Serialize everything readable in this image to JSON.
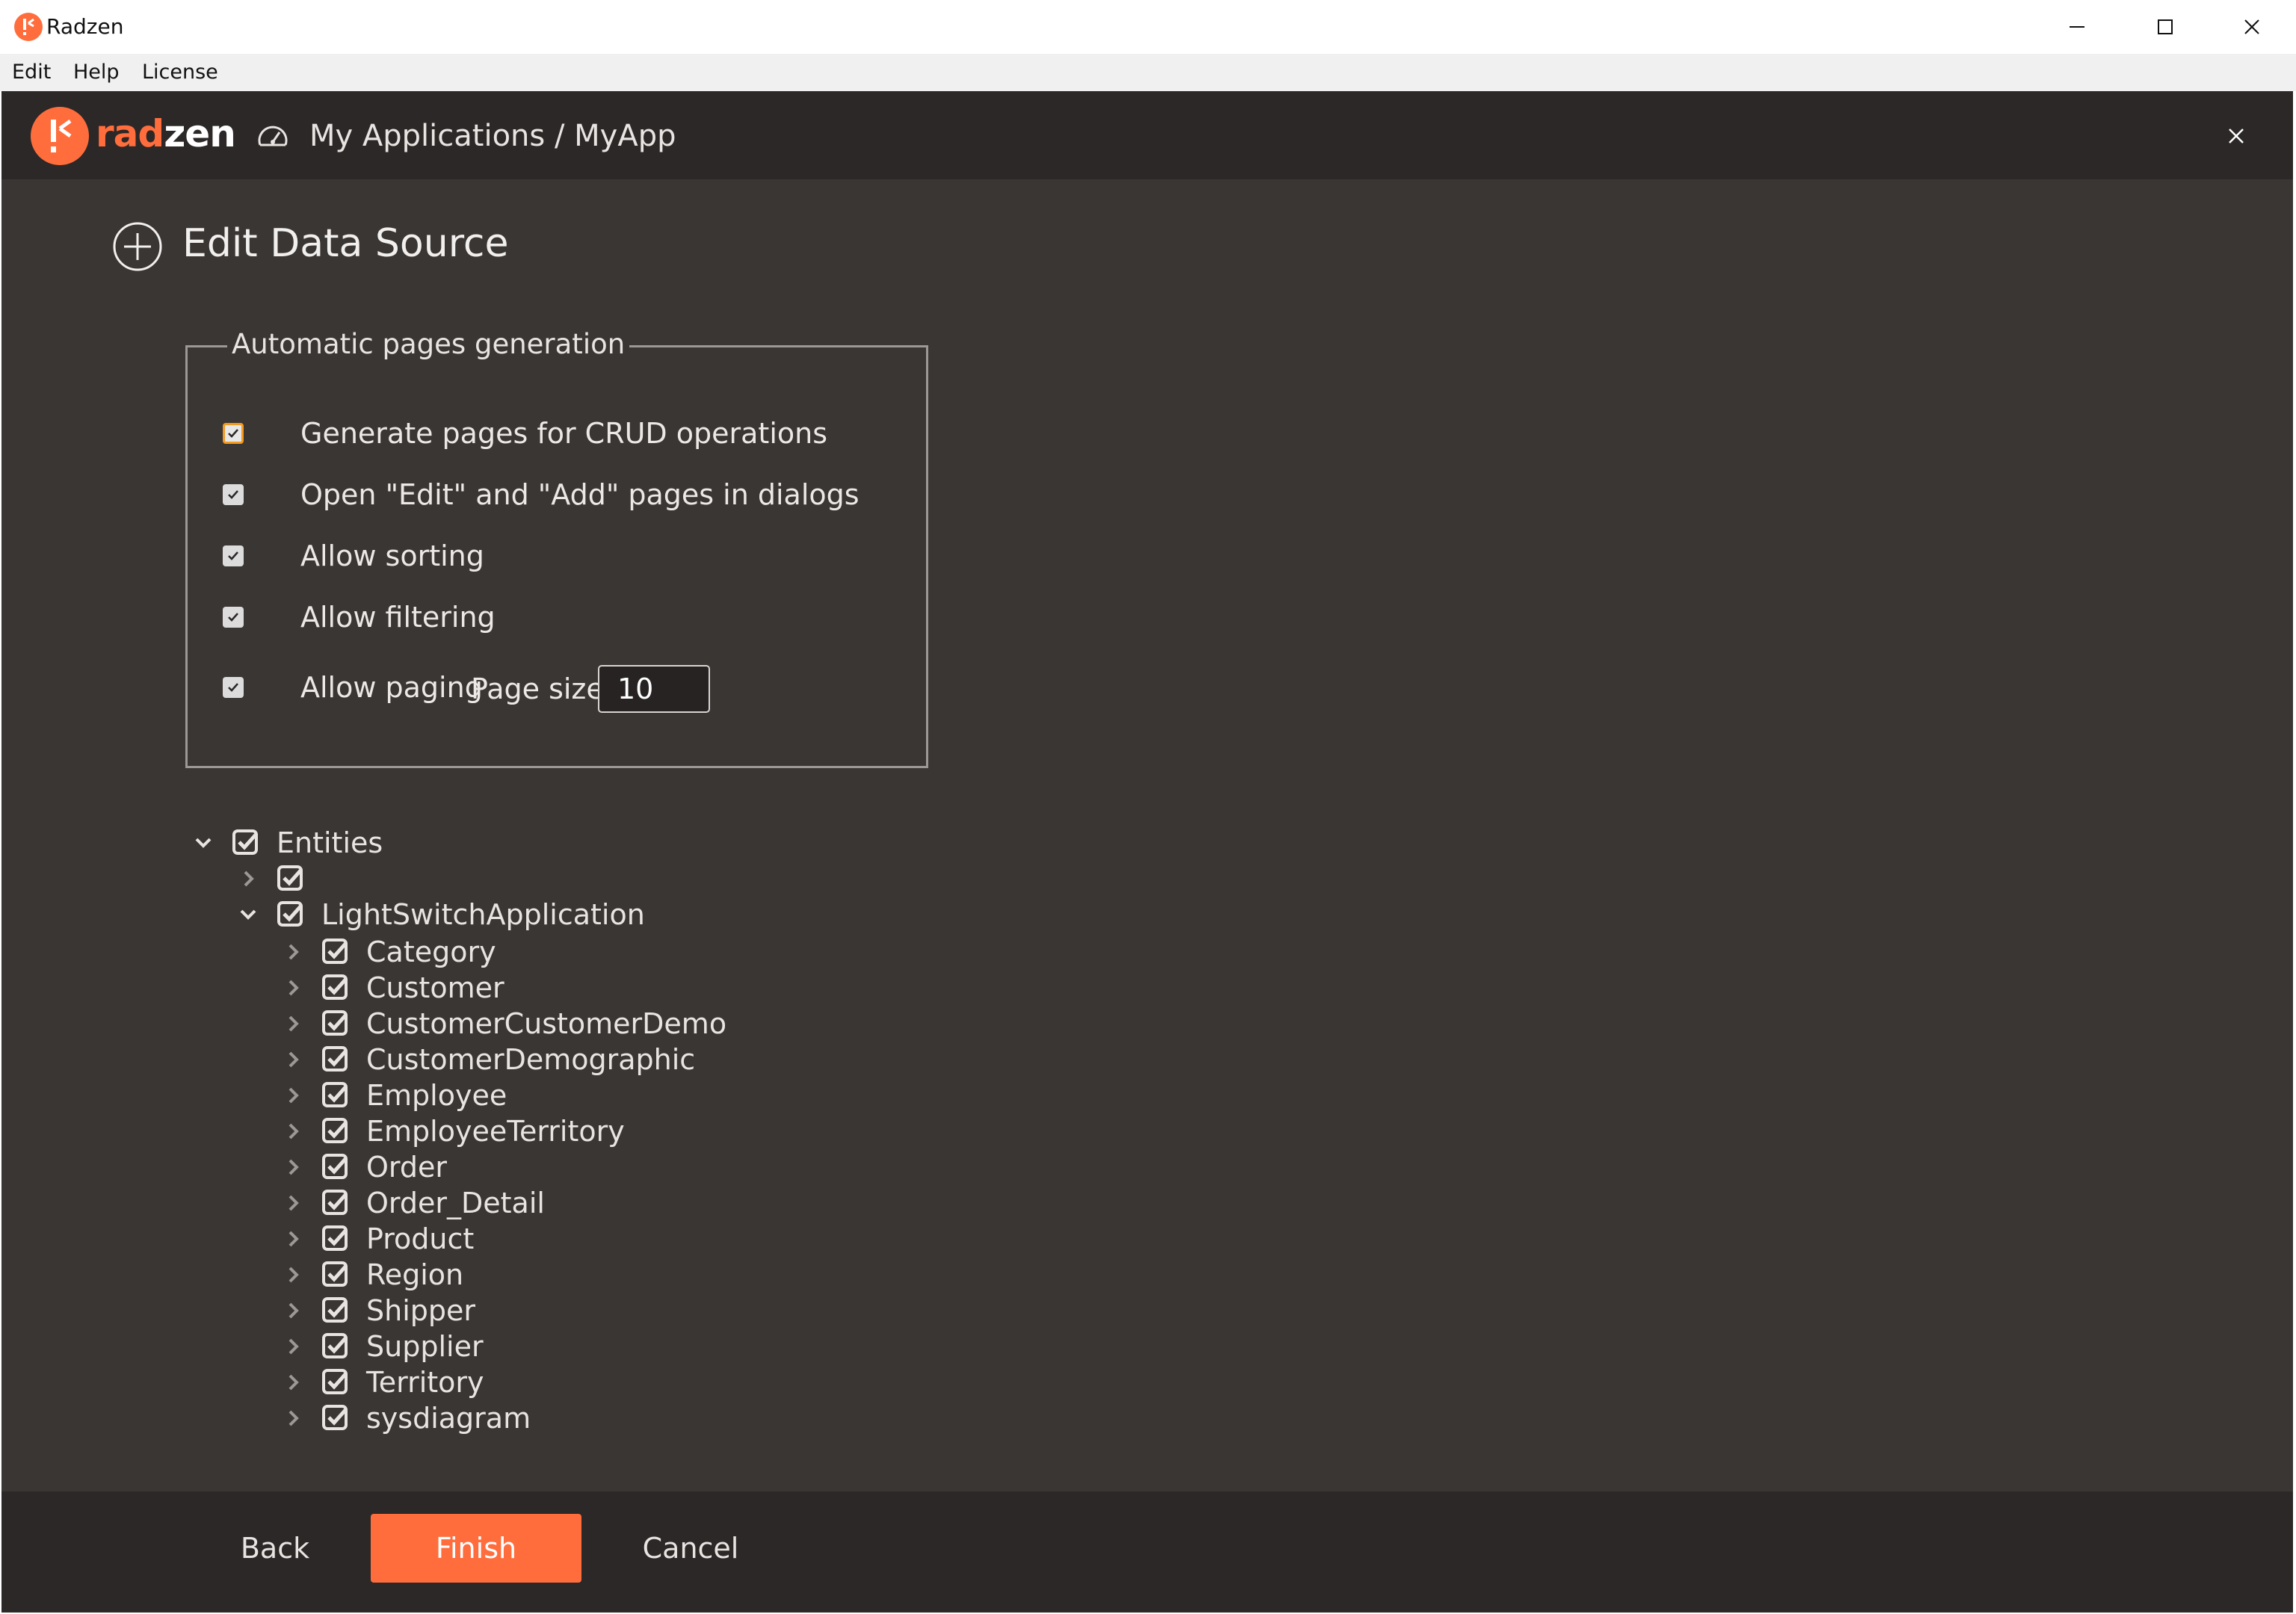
{
  "window": {
    "title": "Radzen",
    "controls": [
      "minimize-icon",
      "maximize-icon",
      "close-icon"
    ]
  },
  "menu": [
    "Edit",
    "Help",
    "License"
  ],
  "header": {
    "brand_rad": "rad",
    "brand_zen": "zen",
    "breadcrumb": "My Applications / MyApp",
    "close_icon": "close-icon"
  },
  "page": {
    "title": "Edit Data Source",
    "title_icon": "plus-circle-icon"
  },
  "automatic_pages": {
    "legend": "Automatic pages generation",
    "options": [
      {
        "label": "Generate pages for CRUD operations",
        "checked": true,
        "focused": true
      },
      {
        "label": "Open \"Edit\" and \"Add\" pages in dialogs",
        "checked": true
      },
      {
        "label": "Allow sorting",
        "checked": true
      },
      {
        "label": "Allow filtering",
        "checked": true
      },
      {
        "label": "Allow paging",
        "checked": true
      }
    ],
    "page_size_label": "Page size",
    "page_size_value": "10"
  },
  "tree": {
    "root": {
      "label": "Entities",
      "expanded": true,
      "checked": true
    },
    "unnamed_node": {
      "label": "",
      "expanded": false,
      "checked": true
    },
    "schema": {
      "label": "LightSwitchApplication",
      "expanded": true,
      "checked": true
    },
    "entities": [
      "Category",
      "Customer",
      "CustomerCustomerDemo",
      "CustomerDemographic",
      "Employee",
      "EmployeeTerritory",
      "Order",
      "Order_Detail",
      "Product",
      "Region",
      "Shipper",
      "Supplier",
      "Territory",
      "sysdiagram"
    ]
  },
  "footer": {
    "back_label": "Back",
    "finish_label": "Finish",
    "cancel_label": "Cancel"
  },
  "colors": {
    "accent": "#ff6d3d",
    "panel": "#3a3634",
    "header": "#2b2827",
    "focus": "#f29a22"
  }
}
